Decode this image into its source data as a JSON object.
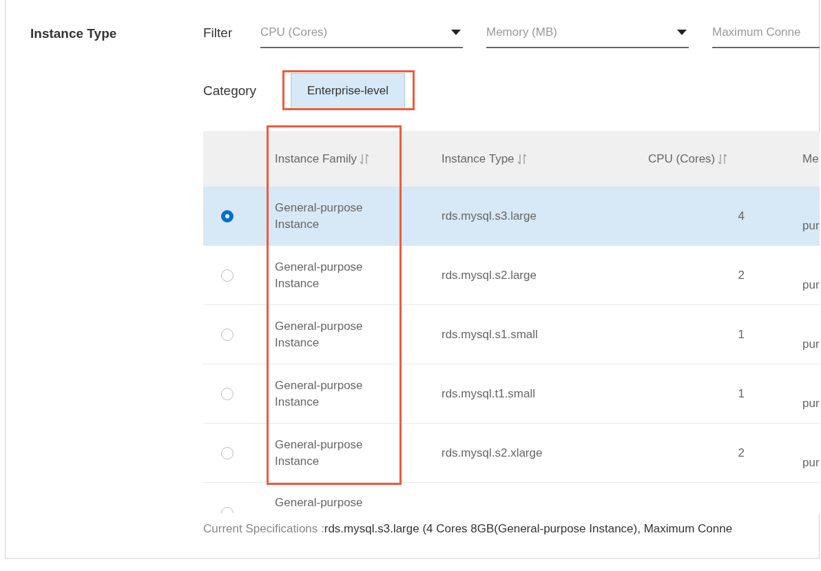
{
  "section_title": "Instance Type",
  "filter": {
    "label": "Filter",
    "dropdowns": [
      {
        "placeholder": "CPU (Cores)"
      },
      {
        "placeholder": "Memory (MB)"
      },
      {
        "placeholder": "Maximum Conne"
      }
    ]
  },
  "category": {
    "label": "Category",
    "options": [
      {
        "label": "Enterprise-level",
        "selected": true
      }
    ]
  },
  "table": {
    "columns": [
      {
        "label": "Instance Family"
      },
      {
        "label": "Instance Type"
      },
      {
        "label": "CPU (Cores)"
      },
      {
        "label": "Me"
      }
    ],
    "rows": [
      {
        "selected": true,
        "family": "General-purpose Instance",
        "type": "rds.mysql.s3.large",
        "cpu": "4",
        "column_4": "pur"
      },
      {
        "selected": false,
        "family": "General-purpose Instance",
        "type": "rds.mysql.s2.large",
        "cpu": "2",
        "column_4": "pur"
      },
      {
        "selected": false,
        "family": "General-purpose Instance",
        "type": "rds.mysql.s1.small",
        "cpu": "1",
        "column_4": "pur"
      },
      {
        "selected": false,
        "family": "General-purpose Instance",
        "type": "rds.mysql.t1.small",
        "cpu": "1",
        "column_4": "pur"
      },
      {
        "selected": false,
        "family": "General-purpose Instance",
        "type": "rds.mysql.s2.xlarge",
        "cpu": "2",
        "column_4": "pur"
      },
      {
        "selected": false,
        "family": "General-purpose"
      }
    ]
  },
  "current_specifications": {
    "label": "Current Specifications :",
    "value": "rds.mysql.s3.large (4 Cores 8GB(General-purpose Instance), Maximum Conne"
  }
}
